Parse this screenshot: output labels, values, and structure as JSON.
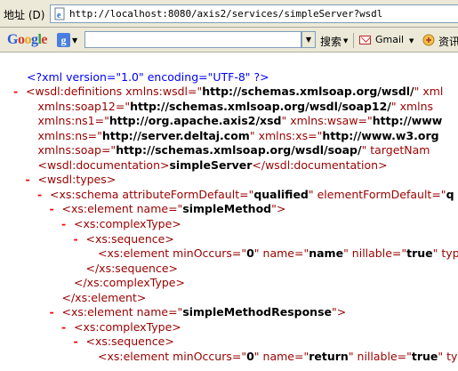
{
  "address_bar": {
    "label": "地址 (D)",
    "url": "http://localhost:8080/axis2/services/simpleServer?wsdl",
    "page_icon": "ie-page-icon"
  },
  "google_toolbar": {
    "logo_letters": [
      "G",
      "o",
      "o",
      "g",
      "l",
      "e"
    ],
    "engine_icon": "g",
    "search_value": "",
    "search_label": "搜索",
    "gmail_label": "Gmail",
    "news_label": "资讯"
  },
  "xml": {
    "pi": "<?xml version=\"1.0\" encoding=\"UTF-8\" ?>",
    "lines": [
      {
        "indent": 0,
        "minus": true,
        "segments": [
          [
            "tag",
            "<wsdl:definitions "
          ],
          [
            "aname",
            "xmlns:wsdl"
          ],
          [
            "tag",
            "=\""
          ],
          [
            "val",
            "http://schemas.xmlsoap.org/wsdl/"
          ],
          [
            "tag",
            "\" xml"
          ]
        ]
      },
      {
        "indent": 1,
        "minus": false,
        "segments": [
          [
            "aname",
            "xmlns:soap12"
          ],
          [
            "tag",
            "=\""
          ],
          [
            "val",
            "http://schemas.xmlsoap.org/wsdl/soap12/"
          ],
          [
            "tag",
            "\" xmlns"
          ]
        ]
      },
      {
        "indent": 1,
        "minus": false,
        "segments": [
          [
            "aname",
            "xmlns:ns1"
          ],
          [
            "tag",
            "=\""
          ],
          [
            "val",
            "http://org.apache.axis2/xsd"
          ],
          [
            "tag",
            "\" "
          ],
          [
            "aname",
            "xmlns:wsaw"
          ],
          [
            "tag",
            "=\""
          ],
          [
            "val",
            "http://www"
          ]
        ]
      },
      {
        "indent": 1,
        "minus": false,
        "segments": [
          [
            "aname",
            "xmlns:ns"
          ],
          [
            "tag",
            "=\""
          ],
          [
            "val",
            "http://server.deltaj.com"
          ],
          [
            "tag",
            "\" "
          ],
          [
            "aname",
            "xmlns:xs"
          ],
          [
            "tag",
            "=\""
          ],
          [
            "val",
            "http://www.w3.org"
          ]
        ]
      },
      {
        "indent": 1,
        "minus": false,
        "segments": [
          [
            "aname",
            "xmlns:soap"
          ],
          [
            "tag",
            "=\""
          ],
          [
            "val",
            "http://schemas.xmlsoap.org/wsdl/soap/"
          ],
          [
            "tag",
            "\" targetNam"
          ]
        ]
      },
      {
        "indent": 1,
        "minus": false,
        "segments": [
          [
            "tag",
            "<wsdl:documentation>"
          ],
          [
            "text",
            "simpleServer"
          ],
          [
            "tag",
            "</wsdl:documentation>"
          ]
        ]
      },
      {
        "indent": 1,
        "minus": true,
        "segments": [
          [
            "tag",
            "<wsdl:types>"
          ]
        ]
      },
      {
        "indent": 2,
        "minus": true,
        "segments": [
          [
            "tag",
            "<xs:schema "
          ],
          [
            "aname",
            "attributeFormDefault"
          ],
          [
            "tag",
            "=\""
          ],
          [
            "val",
            "qualified"
          ],
          [
            "tag",
            "\" "
          ],
          [
            "aname",
            "elementFormDefault"
          ],
          [
            "tag",
            "=\""
          ],
          [
            "val",
            "q"
          ]
        ]
      },
      {
        "indent": 3,
        "minus": true,
        "segments": [
          [
            "tag",
            "<xs:element "
          ],
          [
            "aname",
            "name"
          ],
          [
            "tag",
            "=\""
          ],
          [
            "val",
            "simpleMethod"
          ],
          [
            "tag",
            "\">"
          ]
        ]
      },
      {
        "indent": 4,
        "minus": true,
        "segments": [
          [
            "tag",
            "<xs:complexType>"
          ]
        ]
      },
      {
        "indent": 5,
        "minus": true,
        "segments": [
          [
            "tag",
            "<xs:sequence>"
          ]
        ]
      },
      {
        "indent": 6,
        "minus": false,
        "segments": [
          [
            "tag",
            "<xs:element "
          ],
          [
            "aname",
            "minOccurs"
          ],
          [
            "tag",
            "=\""
          ],
          [
            "val",
            "0"
          ],
          [
            "tag",
            "\" "
          ],
          [
            "aname",
            "name"
          ],
          [
            "tag",
            "=\""
          ],
          [
            "val",
            "name"
          ],
          [
            "tag",
            "\" "
          ],
          [
            "aname",
            "nillable"
          ],
          [
            "tag",
            "=\""
          ],
          [
            "val",
            "true"
          ],
          [
            "tag",
            "\" typ"
          ]
        ]
      },
      {
        "indent": 5,
        "minus": false,
        "segments": [
          [
            "tag",
            "</xs:sequence>"
          ]
        ]
      },
      {
        "indent": 4,
        "minus": false,
        "segments": [
          [
            "tag",
            "</xs:complexType>"
          ]
        ]
      },
      {
        "indent": 3,
        "minus": false,
        "segments": [
          [
            "tag",
            "</xs:element>"
          ]
        ]
      },
      {
        "indent": 3,
        "minus": true,
        "segments": [
          [
            "tag",
            "<xs:element "
          ],
          [
            "aname",
            "name"
          ],
          [
            "tag",
            "=\""
          ],
          [
            "val",
            "simpleMethodResponse"
          ],
          [
            "tag",
            "\">"
          ]
        ]
      },
      {
        "indent": 4,
        "minus": true,
        "segments": [
          [
            "tag",
            "<xs:complexType>"
          ]
        ]
      },
      {
        "indent": 5,
        "minus": true,
        "segments": [
          [
            "tag",
            "<xs:sequence>"
          ]
        ]
      },
      {
        "indent": 6,
        "minus": false,
        "segments": [
          [
            "tag",
            "<xs:element "
          ],
          [
            "aname",
            "minOccurs"
          ],
          [
            "tag",
            "=\""
          ],
          [
            "val",
            "0"
          ],
          [
            "tag",
            "\" "
          ],
          [
            "aname",
            "name"
          ],
          [
            "tag",
            "=\""
          ],
          [
            "val",
            "return"
          ],
          [
            "tag",
            "\" "
          ],
          [
            "aname",
            "nillable"
          ],
          [
            "tag",
            "=\""
          ],
          [
            "val",
            "true"
          ],
          [
            "tag",
            "\" typ"
          ]
        ]
      }
    ]
  }
}
